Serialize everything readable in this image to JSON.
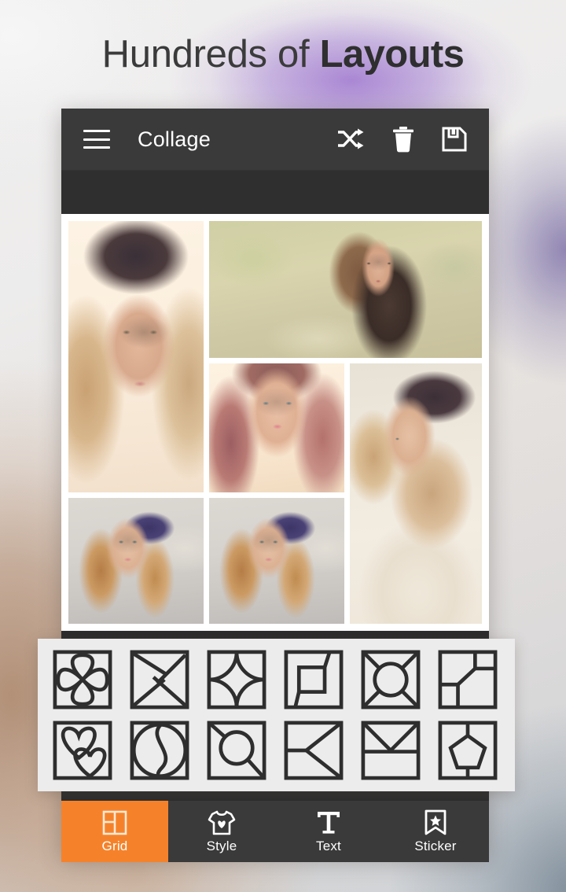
{
  "headline": {
    "prefix": "Hundreds of ",
    "emphasis": "Layouts"
  },
  "appbar": {
    "menu_icon": "hamburger-menu-icon",
    "title": "Collage",
    "actions": [
      {
        "name": "shuffle-button",
        "icon": "shuffle-icon"
      },
      {
        "name": "delete-button",
        "icon": "trash-icon"
      },
      {
        "name": "save-button",
        "icon": "floppy-save-icon"
      }
    ]
  },
  "collage": {
    "cells": [
      {
        "id": "cell-1",
        "icon": "photo-blonde-beanie-portrait"
      },
      {
        "id": "cell-2",
        "icon": "photo-brunette-outdoor"
      },
      {
        "id": "cell-3",
        "icon": "photo-auburn-closeup"
      },
      {
        "id": "cell-4",
        "icon": "photo-profile-beanie"
      },
      {
        "id": "cell-5",
        "icon": "photo-cap-girl-street"
      }
    ]
  },
  "grid_panel": {
    "rows": [
      [
        {
          "name": "layout-flower-petals",
          "label": "Flower petals"
        },
        {
          "name": "layout-pinwheel",
          "label": "Pinwheel"
        },
        {
          "name": "layout-astroid-star",
          "label": "Concave star"
        },
        {
          "name": "layout-offset-square",
          "label": "Offset square"
        },
        {
          "name": "layout-circle-rays",
          "label": "Circle with rays"
        },
        {
          "name": "layout-angled-panels",
          "label": "Angled panels"
        }
      ],
      [
        {
          "name": "layout-double-heart",
          "label": "Double heart"
        },
        {
          "name": "layout-yin-yang",
          "label": "S-split circle"
        },
        {
          "name": "layout-circle-diagonal",
          "label": "Circle diagonal"
        },
        {
          "name": "layout-left-arrow",
          "label": "Left arrow split"
        },
        {
          "name": "layout-envelope",
          "label": "Envelope"
        },
        {
          "name": "layout-pentagon",
          "label": "Pentagon"
        }
      ]
    ]
  },
  "tabbar": {
    "items": [
      {
        "name": "tab-grid",
        "label": "Grid",
        "icon": "grid-layout-icon",
        "active": true
      },
      {
        "name": "tab-style",
        "label": "Style",
        "icon": "tshirt-heart-icon",
        "active": false
      },
      {
        "name": "tab-text",
        "label": "Text",
        "icon": "text-t-icon",
        "active": false
      },
      {
        "name": "tab-sticker",
        "label": "Sticker",
        "icon": "bookmark-star-icon",
        "active": false
      }
    ]
  },
  "colors": {
    "accent_orange": "#f5822a",
    "appbar_dark": "#3a3a3a",
    "subbar_dark": "#2f2f2f",
    "panel_gray": "#ececec",
    "headline_text": "#3b3b3b"
  }
}
